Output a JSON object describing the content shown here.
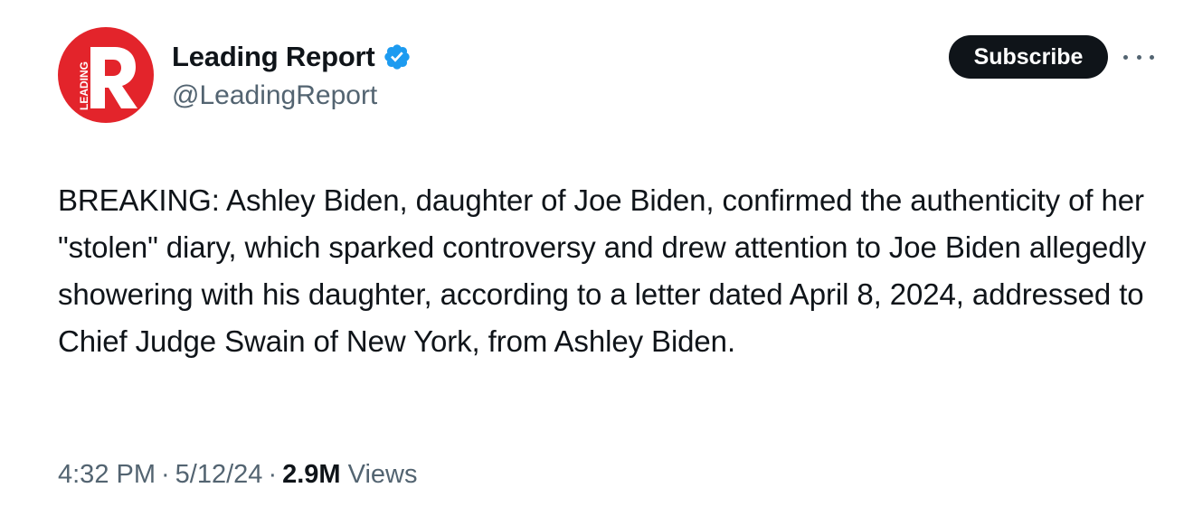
{
  "author": {
    "display_name": "Leading Report",
    "handle": "@LeadingReport",
    "avatar_icon": "leading-report-logo",
    "avatar_color": "#e3242b",
    "avatar_logo_text": "LEADING",
    "verified_icon": "verified-badge-icon",
    "verified_color": "#1d9bf0"
  },
  "actions": {
    "subscribe_label": "Subscribe",
    "more_icon": "more-options-icon"
  },
  "tweet": {
    "text": "BREAKING: Ashley Biden, daughter of Joe Biden, confirmed the authenticity of her \"stolen\" diary, which sparked controversy and drew attention to Joe Biden allegedly showering with his daughter, according to a letter dated April 8, 2024, addressed to Chief Judge Swain of New York, from Ashley Biden."
  },
  "meta": {
    "time": "4:32 PM",
    "separator": "·",
    "date": "5/12/24",
    "views_count": "2.9M",
    "views_label": "Views"
  }
}
